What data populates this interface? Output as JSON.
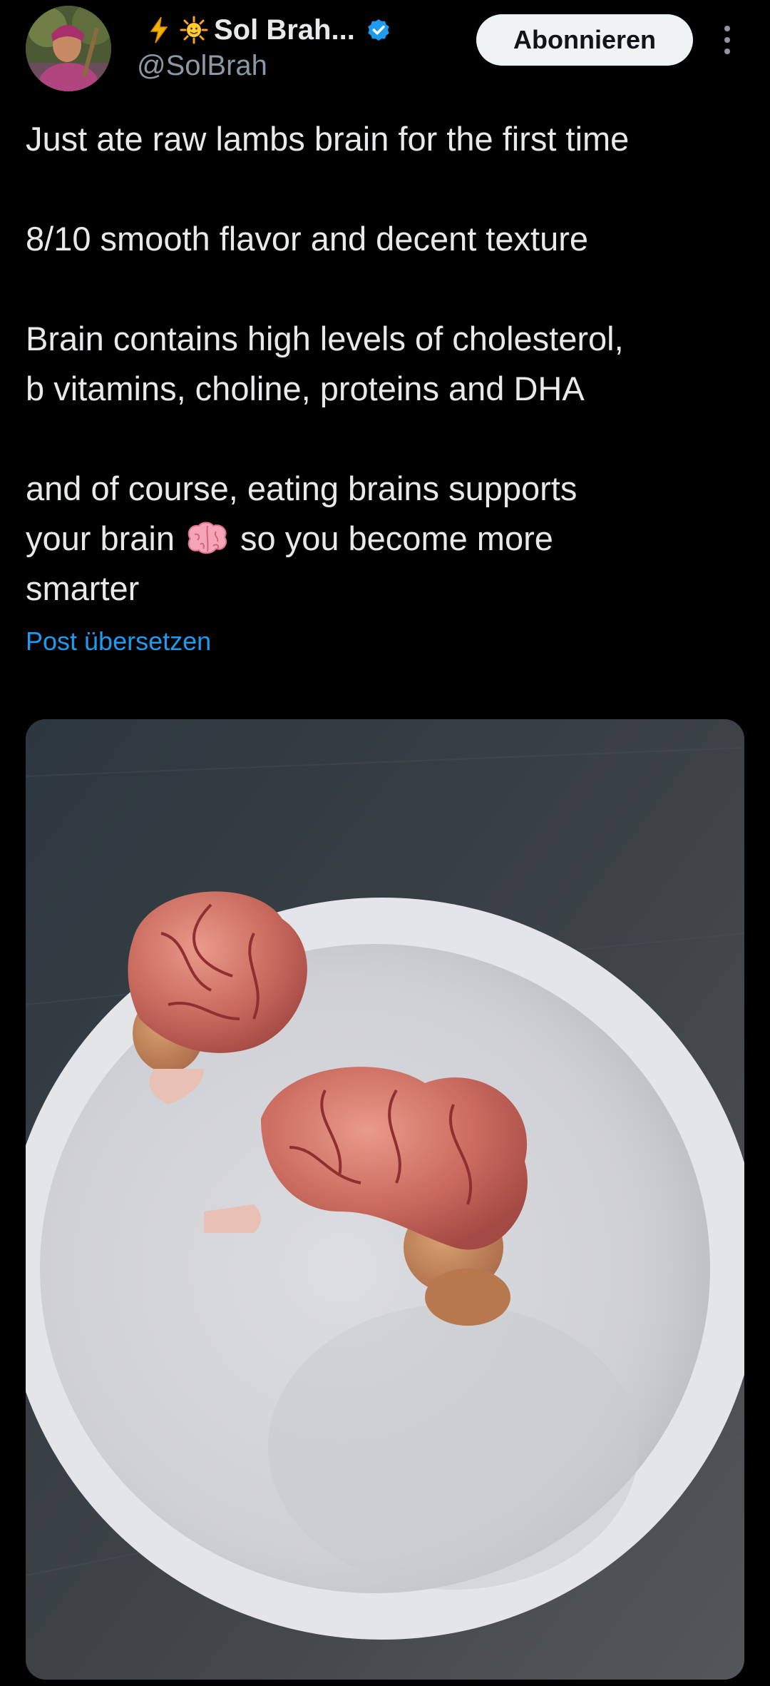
{
  "header": {
    "display_name": "Sol Brah...",
    "handle": "@SolBrah",
    "follow_label": "Abonnieren",
    "name_emojis": [
      "lightning-emoji",
      "sun-emoji"
    ],
    "verified_color": "#1d9bf0"
  },
  "tweet": {
    "line1": "Just ate raw lambs brain for the first time",
    "line2": "8/10 smooth flavor and decent texture",
    "line3a": "Brain contains high levels of cholesterol,",
    "line3b": "b vitamins, choline, proteins and DHA",
    "line4a": "and of course, eating brains supports",
    "line4b_before": "your brain",
    "line4b_after": "so you become more",
    "line4c": "smarter",
    "inline_emoji": "brain-emoji",
    "translate_label": "Post übersetzen"
  },
  "media": {
    "subject": "photo-two-raw-lamb-brains-on-white-plate"
  },
  "colors": {
    "background": "#000000",
    "text": "#e7e9ea",
    "secondary_text": "#8b98a5",
    "link": "#1d9bf0",
    "button_bg": "#eff3f4",
    "button_text": "#0f1419"
  }
}
